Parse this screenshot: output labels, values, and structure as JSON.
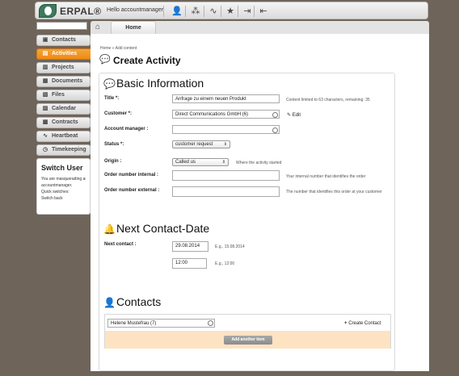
{
  "app": {
    "logo_text": "ERPAL®",
    "greeting": "Hello accountmanager",
    "top_icons": [
      "user-icon",
      "network-icon",
      "heartbeat-icon",
      "star-icon",
      "login-icon",
      "logout-icon"
    ]
  },
  "tabs": {
    "home_label": "Home"
  },
  "sidebar": {
    "items": [
      {
        "label": "Contacts",
        "icon": "contacts-icon",
        "active": false
      },
      {
        "label": "Activities",
        "icon": "activities-icon",
        "active": true
      },
      {
        "label": "Projects",
        "icon": "projects-icon",
        "active": false
      },
      {
        "label": "Documents",
        "icon": "documents-icon",
        "active": false
      },
      {
        "label": "Files",
        "icon": "files-icon",
        "active": false
      },
      {
        "label": "Calendar",
        "icon": "calendar-icon",
        "active": false
      },
      {
        "label": "Contracts",
        "icon": "contracts-icon",
        "active": false
      },
      {
        "label": "Heartbeat",
        "icon": "heartbeat-icon",
        "active": false
      },
      {
        "label": "Timekeeping",
        "icon": "timekeeping-icon",
        "active": false
      }
    ],
    "switch_user": {
      "title": "Switch User",
      "line1": "You are masquerading as",
      "line2": "accountmanager.",
      "line3": "Quick switches:",
      "link": "Switch back"
    }
  },
  "main": {
    "breadcrumb": "Home » Add content",
    "page_title": "Create Activity",
    "basic_info": {
      "heading": "Basic Information",
      "title_label": "Title *:",
      "title_value": "Anfrage zu einem neuen Produkt",
      "title_hint": "Content limited to 63 characters, remaining: 35",
      "customer_label": "Customer *:",
      "customer_value": "Direct Communications GmbH  (6)",
      "edit_label": "Edit",
      "account_manager_label": "Account manager :",
      "account_manager_value": "",
      "status_label": "Status *:",
      "status_value": "customer request",
      "origin_label": "Origin :",
      "origin_value": "Called us",
      "origin_hint": "Where the activity started",
      "order_internal_label": "Order number internal :",
      "order_internal_value": "",
      "order_internal_hint": "Your internal number that identifies the order",
      "order_external_label": "Order number external :",
      "order_external_value": "",
      "order_external_hint": "The number that identifies this order at your customer"
    },
    "next_contact": {
      "heading": "Next Contact-Date",
      "label": "Next contact :",
      "date_value": "29.08.2014",
      "date_hint": "E.g., 15.08.2014",
      "time_value": "12:00",
      "time_hint": "E.g., 12:00"
    },
    "contacts": {
      "heading": "Contacts",
      "contact_value": "Helene Mustefrau (7)",
      "create_contact_label": "Create Contact",
      "add_item_label": "Add another item"
    }
  }
}
